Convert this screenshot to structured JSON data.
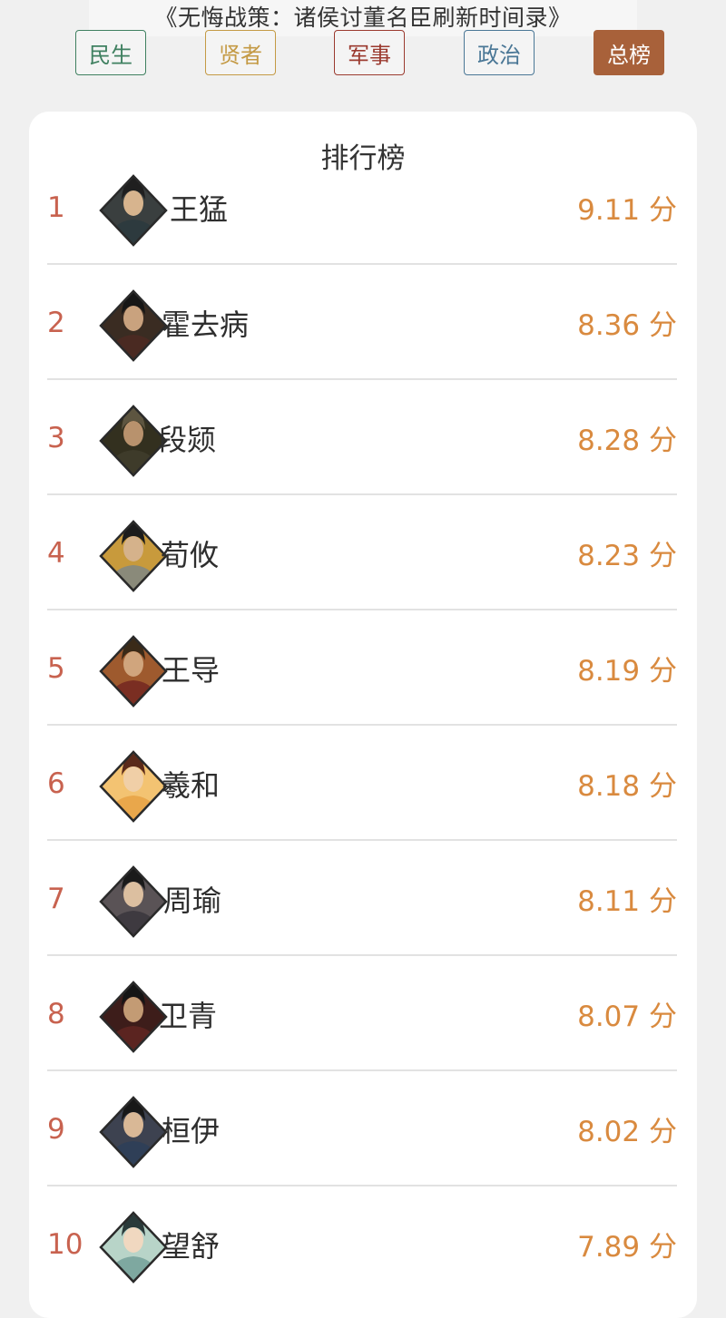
{
  "page_title": "《无悔战策：诸侯讨董名臣刷新时间录》",
  "tabs": [
    {
      "label": "民生",
      "color": "#3f8060",
      "active": false
    },
    {
      "label": "贤者",
      "color": "#c49a45",
      "active": false
    },
    {
      "label": "军事",
      "color": "#9b3a2f",
      "active": false
    },
    {
      "label": "政治",
      "color": "#4a7796",
      "active": false
    },
    {
      "label": "总榜",
      "color": "#a8613a",
      "active": true
    }
  ],
  "ranking": {
    "title": "排行榜",
    "score_unit": "分",
    "items": [
      {
        "rank": "1",
        "name": "王猛",
        "score": "9.11 分",
        "robe": "#2d3a3e",
        "hair": "#1f1f1f",
        "skin": "#d7b48e",
        "bg": "#3a3f3f"
      },
      {
        "rank": "2",
        "name": "霍去病",
        "score": "8.36 分",
        "robe": "#4a2a22",
        "hair": "#161616",
        "skin": "#c9a27e",
        "bg": "#3a2c22"
      },
      {
        "rank": "3",
        "name": "段颎",
        "score": "8.28 分",
        "robe": "#3e3b2a",
        "hair": "#5d5540",
        "skin": "#b8926d",
        "bg": "#33301f"
      },
      {
        "rank": "4",
        "name": "荀攸",
        "score": "8.23 分",
        "robe": "#8a8a7a",
        "hair": "#1c1c1c",
        "skin": "#d5b28b",
        "bg": "#c89a3c"
      },
      {
        "rank": "5",
        "name": "王导",
        "score": "8.19 分",
        "robe": "#7a2e22",
        "hair": "#3a2a18",
        "skin": "#d0a57d",
        "bg": "#9e5a2e"
      },
      {
        "rank": "6",
        "name": "羲和",
        "score": "8.18 分",
        "robe": "#e9a74b",
        "hair": "#5a2a1a",
        "skin": "#f0cfa7",
        "bg": "#f3c372"
      },
      {
        "rank": "7",
        "name": "周瑜",
        "score": "8.11 分",
        "robe": "#3e3a40",
        "hair": "#1a1a1a",
        "skin": "#dcbfa0",
        "bg": "#5a5356"
      },
      {
        "rank": "8",
        "name": "卫青",
        "score": "8.07 分",
        "robe": "#5b2420",
        "hair": "#151515",
        "skin": "#c39b74",
        "bg": "#3d1d1a"
      },
      {
        "rank": "9",
        "name": "桓伊",
        "score": "8.02 分",
        "robe": "#2f3f57",
        "hair": "#181818",
        "skin": "#d9b896",
        "bg": "#3d4250"
      },
      {
        "rank": "10",
        "name": "望舒",
        "score": "7.89 分",
        "robe": "#7ea8a0",
        "hair": "#2a3a3a",
        "skin": "#f0d8c0",
        "bg": "#b8d4c8"
      }
    ]
  }
}
